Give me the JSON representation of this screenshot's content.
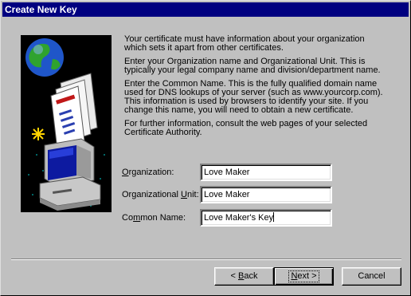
{
  "window": {
    "title": "Create New Key"
  },
  "info": {
    "p1": "Your certificate must have information about your organization which sets it apart from other certificates.",
    "p2": "Enter your Organization name and Organizational Unit. This is typically your legal company name and division/department name.",
    "p3": "Enter the Common Name. This is the fully qualified domain name used for DNS lookups of your server (such as www.yourcorp.com). This information is used by browsers to identify your site. If you change this name, you will need to obtain a new certificate.",
    "p4": "For further information, consult the web pages of your selected Certificate Authority."
  },
  "form": {
    "organization": {
      "label_pre": "",
      "label_acc": "O",
      "label_post": "rganization:",
      "value": "Love Maker"
    },
    "org_unit": {
      "label_pre": "Organizational ",
      "label_acc": "U",
      "label_post": "nit:",
      "value": "Love Maker"
    },
    "common_name": {
      "label_pre": "Co",
      "label_acc": "m",
      "label_post": "mon Name:",
      "value": "Love Maker's Key"
    }
  },
  "buttons": {
    "back": {
      "prefix": "< ",
      "acc": "B",
      "rest": "ack"
    },
    "next": {
      "acc": "N",
      "rest": "ext >"
    },
    "cancel": {
      "label": "Cancel"
    }
  },
  "colors": {
    "titlebar": "#000080",
    "face": "#c0c0c0",
    "art_bg": "#000000"
  },
  "icons": {
    "wizard_art": "computer-globe-certificate-illustration"
  }
}
